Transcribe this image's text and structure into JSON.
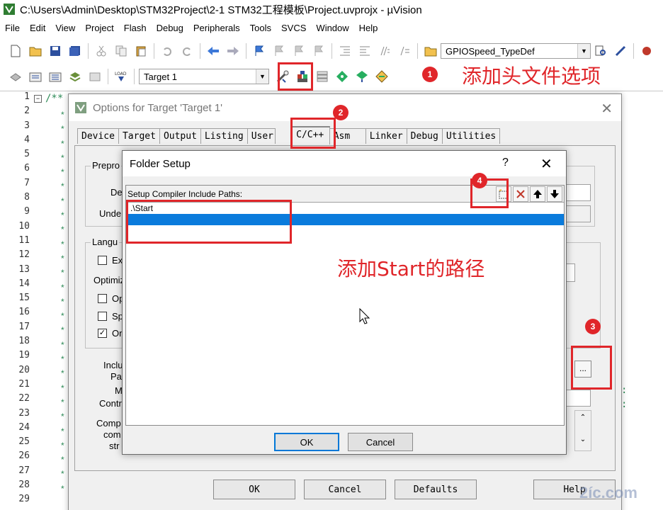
{
  "window": {
    "title": "C:\\Users\\Admin\\Desktop\\STM32Project\\2-1 STM32工程模板\\Project.uvprojx - µVision"
  },
  "menu": [
    "File",
    "Edit",
    "View",
    "Project",
    "Flash",
    "Debug",
    "Peripherals",
    "Tools",
    "SVCS",
    "Window",
    "Help"
  ],
  "toolbar1": {
    "combo_value": "GPIOSpeed_TypeDef"
  },
  "toolbar2": {
    "target_combo": "Target 1"
  },
  "editor": {
    "line_numbers": [
      "1",
      "2",
      "3",
      "4",
      "5",
      "6",
      "7",
      "8",
      "9",
      "10",
      "11",
      "12",
      "13",
      "14",
      "15",
      "16",
      "17",
      "18",
      "19",
      "20",
      "21",
      "22",
      "23",
      "24",
      "25",
      "26",
      "27",
      "28",
      "29"
    ],
    "first_line_text": "/**",
    "fold_glyph": "−"
  },
  "options_dialog": {
    "title": "Options for Target 'Target 1'",
    "tabs": [
      "Device",
      "Target",
      "Output",
      "Listing",
      "User",
      "C/C++",
      "Asm",
      "Linker",
      "Debug",
      "Utilities"
    ],
    "active_tab": "C/C++",
    "labels": {
      "preprocessor": "Prepro",
      "define": "De",
      "undefine": "Unde",
      "language": "Langu",
      "execute_only": "Ex",
      "optimization": "Optimiz",
      "opt1": "Op",
      "split": "Sp",
      "one_elf": "On",
      "include_paths": "Inclu",
      "include_paths2": "Pa",
      "misc": "M",
      "controls": "Contr",
      "compiler": "Comp",
      "compiler2": "com",
      "compiler3": "str"
    },
    "one_elf_checked": "✓",
    "ellipsis_label": "...",
    "buttons": {
      "ok": "OK",
      "cancel": "Cancel",
      "defaults": "Defaults",
      "help": "Help"
    }
  },
  "folder_dialog": {
    "title": "Folder Setup",
    "help": "?",
    "close": "✕",
    "list_header": "Setup Compiler Include Paths:",
    "rows": [
      ".\\Start",
      ""
    ],
    "selected_row": 1,
    "ok": "OK",
    "cancel": "Cancel"
  },
  "annotations": {
    "step1_badge": "1",
    "step1_text": "添加头文件选项",
    "step2_badge": "2",
    "step3_badge": "3",
    "step4_badge": "4",
    "path_text": "添加Start的路径"
  },
  "watermark": "2íc.com",
  "colors": {
    "annotation_red": "#e0262a",
    "selection_blue": "#0a7bdc"
  }
}
